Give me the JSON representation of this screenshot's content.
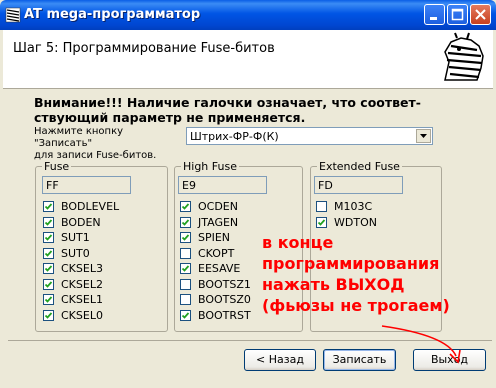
{
  "window": {
    "title": "AT mega-программатор"
  },
  "header": {
    "step_title": "Шаг 5: Программирование Fuse-битов"
  },
  "warning": "Внимание!!! Наличие галочки означает, что соответ-ствующий параметр не применяется.",
  "warning_lines": [
    "Внимание!!! Наличие галочки означает, что соответ-",
    "ствующий параметр не применяется."
  ],
  "hint": [
    "Нажмите кнопку \"Записать\"",
    "для записи Fuse-битов."
  ],
  "device_select": {
    "value": "Штрих-ФР-Ф(К)"
  },
  "fuse": {
    "legend": "Fuse",
    "value": "FF",
    "bits": [
      {
        "label": "BODLEVEL",
        "checked": true
      },
      {
        "label": "BODEN",
        "checked": true
      },
      {
        "label": "SUT1",
        "checked": true
      },
      {
        "label": "SUT0",
        "checked": true
      },
      {
        "label": "CKSEL3",
        "checked": true
      },
      {
        "label": "CKSEL2",
        "checked": true
      },
      {
        "label": "CKSEL1",
        "checked": true
      },
      {
        "label": "CKSEL0",
        "checked": true
      }
    ]
  },
  "high_fuse": {
    "legend": "High Fuse",
    "value": "E9",
    "bits": [
      {
        "label": "OCDEN",
        "checked": true
      },
      {
        "label": "JTAGEN",
        "checked": true
      },
      {
        "label": "SPIEN",
        "checked": true
      },
      {
        "label": "CKOPT",
        "checked": false
      },
      {
        "label": "EESAVE",
        "checked": true
      },
      {
        "label": "BOOTSZ1",
        "checked": false
      },
      {
        "label": "BOOTSZ0",
        "checked": false
      },
      {
        "label": "BOOTRST",
        "checked": true
      }
    ]
  },
  "extended_fuse": {
    "legend": "Extended Fuse",
    "value": "FD",
    "bits": [
      {
        "label": "M103C",
        "checked": false
      },
      {
        "label": "WDTON",
        "checked": true
      }
    ]
  },
  "annotation": [
    "в конце",
    "программирования",
    "нажать  ВЫХОД",
    "(фьюзы не трогаем)"
  ],
  "buttons": {
    "back": "< Назад",
    "write": "Записать",
    "exit": "Выход"
  },
  "colors": {
    "annotation": "#ff0000",
    "titlebar": "#0055e5"
  }
}
